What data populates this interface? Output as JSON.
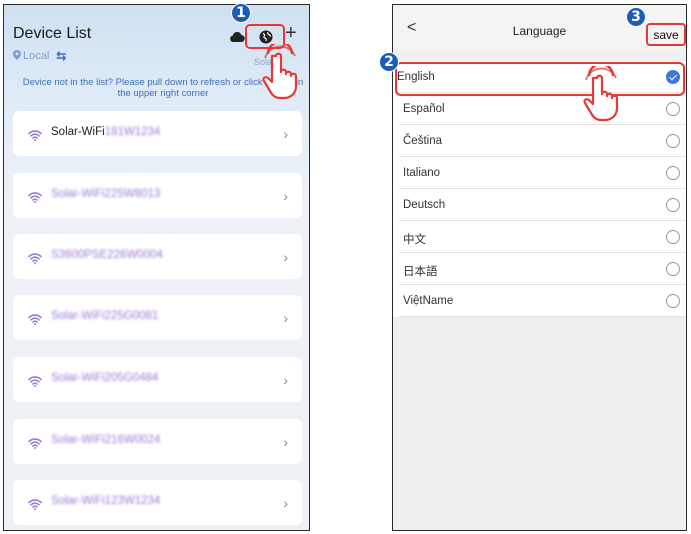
{
  "device_list": {
    "title": "Device List",
    "local_label": "Local",
    "location_text": "Solar",
    "hint": "Device not in the list? Please pull down to refresh or click the \"+\" in the upper right corner",
    "plus_label": "+",
    "devices": [
      {
        "prefix": "Solar-WiFi",
        "blurred": "181W1234"
      },
      {
        "prefix": "",
        "blurred": "Solar-WiFi225W8013"
      },
      {
        "prefix": "",
        "blurred": "S3600PSE226W0004"
      },
      {
        "prefix": "",
        "blurred": "Solar-WiFi225G0081"
      },
      {
        "prefix": "",
        "blurred": "Solar-WiFi205G0484"
      },
      {
        "prefix": "",
        "blurred": "Solar-WiFi216W0024"
      },
      {
        "prefix": "",
        "blurred": "Solar-WiFi123W1234"
      }
    ],
    "chevron": "›",
    "step_badge": "1"
  },
  "language": {
    "back": "<",
    "title": "Language",
    "save_label": "save",
    "step_badge_list": "2",
    "step_badge_save": "3",
    "items": [
      {
        "label": "English",
        "selected": true
      },
      {
        "label": "Español",
        "selected": false
      },
      {
        "label": "Čeština",
        "selected": false
      },
      {
        "label": "Italiano",
        "selected": false
      },
      {
        "label": "Deutsch",
        "selected": false
      },
      {
        "label": "中文",
        "selected": false
      },
      {
        "label": "日本語",
        "selected": false
      },
      {
        "label": "ViệtName",
        "selected": false
      }
    ]
  },
  "colors": {
    "accent_blue": "#1e5bb8",
    "highlight_red": "#e53935",
    "wifi_purple": "#9b7bd8"
  }
}
